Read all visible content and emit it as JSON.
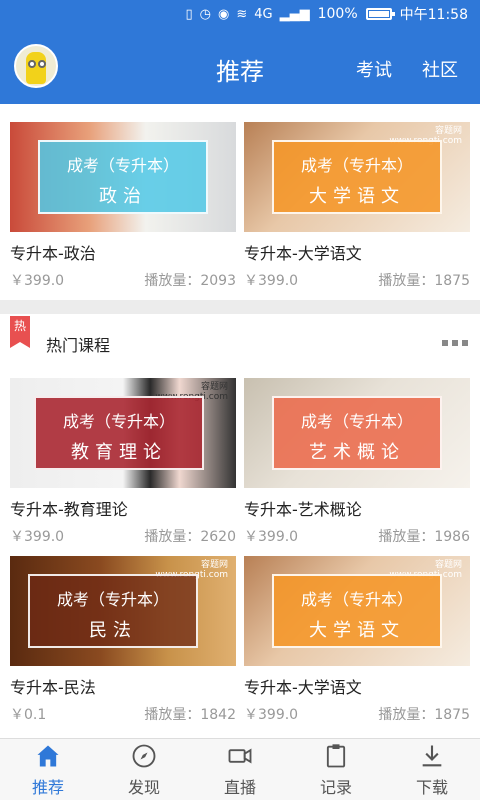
{
  "status_bar": {
    "icons": [
      "vibrate-icon",
      "alarm-icon",
      "eye-icon",
      "wifi-icon",
      "signal-icon"
    ],
    "network": "4G",
    "battery": "100%",
    "time": "中午11:58"
  },
  "header": {
    "title": "推荐",
    "nav_exam": "考试",
    "nav_community": "社区"
  },
  "colors": {
    "accent": "#2f78d8",
    "hot": "#e85050"
  },
  "top_courses": [
    {
      "line1": "成考（专升本）",
      "line2": "政治",
      "name": "专升本-政治",
      "price": "￥399.0",
      "plays": "播放量：2093"
    },
    {
      "line1": "成考（专升本）",
      "line2": "大学语文",
      "watermark": "容题网\nwww.rongti.com",
      "name": "专升本-大学语文",
      "price": "￥399.0",
      "plays": "播放量：1875"
    }
  ],
  "hot_section": {
    "badge": "热",
    "title": "热门课程"
  },
  "hot_courses": [
    {
      "line1": "成考（专升本）",
      "line2": "教育理论",
      "watermark": "容题网\nwww.rongti.com",
      "name": "专升本-教育理论",
      "price": "￥399.0",
      "plays": "播放量：2620"
    },
    {
      "line1": "成考（专升本）",
      "line2": "艺术概论",
      "name": "专升本-艺术概论",
      "price": "￥399.0",
      "plays": "播放量：1986"
    },
    {
      "line1": "成考（专升本）",
      "line2": "民法",
      "watermark": "容题网\nwww.rongti.com",
      "name": "专升本-民法",
      "price": "￥0.1",
      "plays": "播放量：1842"
    },
    {
      "line1": "成考（专升本）",
      "line2": "大学语文",
      "watermark": "容题网\nwww.rongti.com",
      "name": "专升本-大学语文",
      "price": "￥399.0",
      "plays": "播放量：1875"
    }
  ],
  "tabs": [
    {
      "label": "推荐",
      "icon": "home-icon"
    },
    {
      "label": "发现",
      "icon": "compass-icon"
    },
    {
      "label": "直播",
      "icon": "video-icon"
    },
    {
      "label": "记录",
      "icon": "clipboard-icon"
    },
    {
      "label": "下载",
      "icon": "download-icon"
    }
  ]
}
